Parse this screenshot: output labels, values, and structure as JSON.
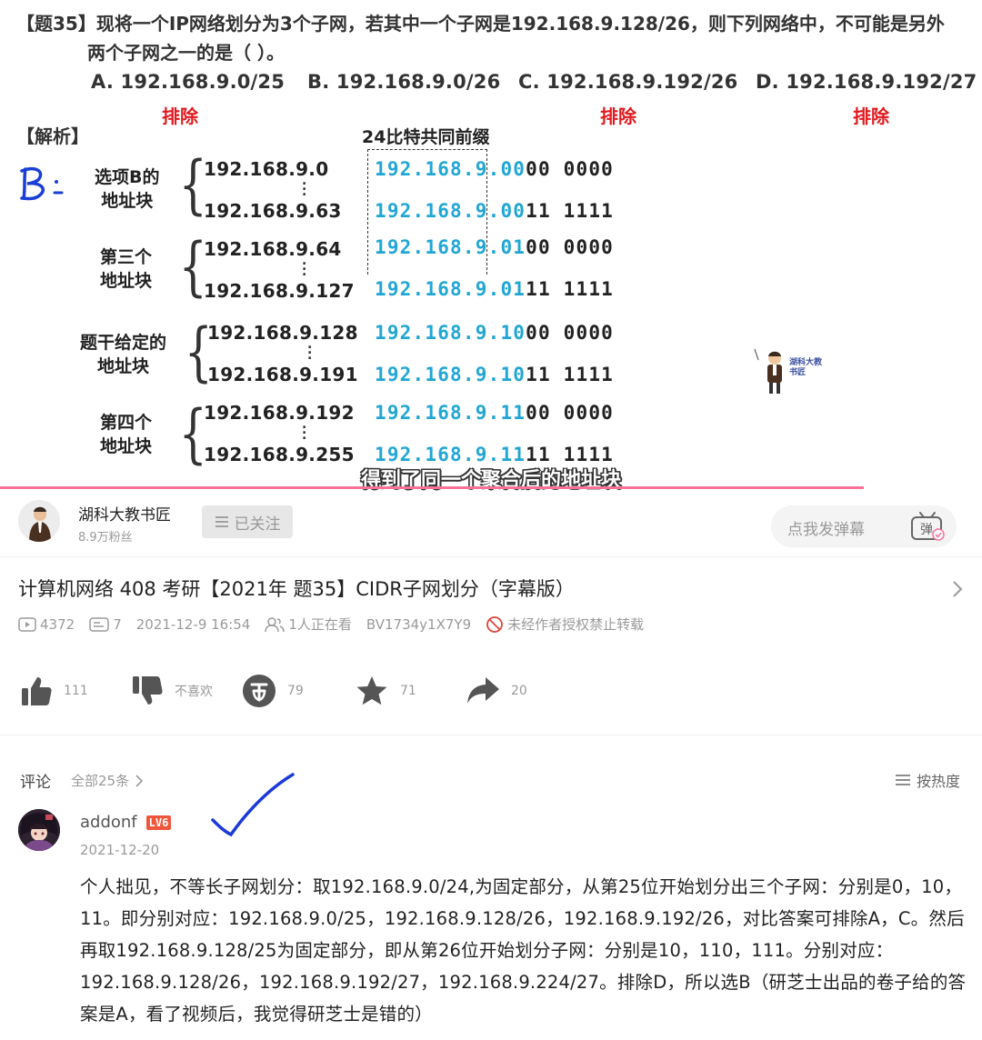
{
  "video": {
    "question_line1": "【题35】现将一个IP网络划分为3个子网，若其中一个子网是192.168.9.128/26，则下列网络中，不可能是另外",
    "question_line2": "两个子网之一的是（      ）。",
    "options": [
      "A. 192.168.9.0/25",
      "B. 192.168.9.0/26",
      "C. 192.168.9.192/26",
      "D. 192.168.9.192/27"
    ],
    "exclude_label": "排除",
    "analysis_label": "【解析】",
    "prefix_title": "24比特共同前缀",
    "hand_note": "B:",
    "blocks": [
      {
        "label1": "选项B的",
        "label2": "地址块",
        "ip_start": "192.168.9.0",
        "ip_end": "192.168.9.63",
        "bin_start_prefix": "192.168.9.",
        "bin_start_net": "00",
        "bin_start_host": "00 0000",
        "bin_end_prefix": "192.168.9.",
        "bin_end_net": "00",
        "bin_end_host": "11 1111"
      },
      {
        "label1": "第三个",
        "label2": "地址块",
        "ip_start": "192.168.9.64",
        "ip_end": "192.168.9.127",
        "bin_start_prefix": "192.168.9.",
        "bin_start_net": "01",
        "bin_start_host": "00 0000",
        "bin_end_prefix": "192.168.9.",
        "bin_end_net": "01",
        "bin_end_host": "11 1111"
      },
      {
        "label1": "题干给定的",
        "label2": "地址块",
        "ip_start": "192.168.9.128",
        "ip_end": "192.168.9.191",
        "bin_start_prefix": "192.168.9.",
        "bin_start_net": "10",
        "bin_start_host": "00 0000",
        "bin_end_prefix": "192.168.9.",
        "bin_end_net": "10",
        "bin_end_host": "11 1111"
      },
      {
        "label1": "第四个",
        "label2": "地址块",
        "ip_start": "192.168.9.192",
        "ip_end": "192.168.9.255",
        "bin_start_prefix": "192.168.9.",
        "bin_start_net": "11",
        "bin_start_host": "00 0000",
        "bin_end_prefix": "192.168.9.",
        "bin_end_net": "11",
        "bin_end_host": "11 1111"
      }
    ],
    "mascot_text": "湖科大教书匠",
    "subtitle": "得到了同一个聚合后的地址块",
    "progress": 0.88,
    "colors": {
      "accent_pink": "#fb7299",
      "exclude_red": "#e0191e",
      "binary_cyan": "#21a6d4"
    }
  },
  "uploader": {
    "name": "湖科大教书匠",
    "fans": "8.9万粉丝",
    "follow_label": "已关注",
    "danmu_placeholder": "点我发弹幕",
    "danmu_icon_text": "弹"
  },
  "info": {
    "title": "计算机网络 408 考研【2021年 题35】CIDR子网划分（字幕版）",
    "views": "4372",
    "danmaku_count": "7",
    "datetime": "2021-12-9 16:54",
    "watching": "1人正在看",
    "bvid": "BV1734y1X7Y9",
    "copyright": "未经作者授权禁止转载"
  },
  "actions": {
    "like": "111",
    "dislike": "不喜欢",
    "coin": "79",
    "favorite": "71",
    "share": "20"
  },
  "comments": {
    "header": "评论",
    "all": "全部25条",
    "sort": "按热度",
    "items": [
      {
        "user": "addonf",
        "level": "LV6",
        "date": "2021-12-20",
        "text": "个人拙见，不等长子网划分：取192.168.9.0/24,为固定部分，从第25位开始划分出三个子网：分别是0，10，11。即分别对应：192.168.9.0/25，192.168.9.128/26，192.168.9.192/26，对比答案可排除A，C。然后再取192.168.9.128/25为固定部分，即从第26位开始划分子网：分别是10，110，111。分别对应：192.168.9.128/26，192.168.9.192/27，192.168.9.224/27。排除D，所以选B（研芝士出品的卷子给的答案是A，看了视频后，我觉得研芝士是错的）"
      }
    ]
  }
}
